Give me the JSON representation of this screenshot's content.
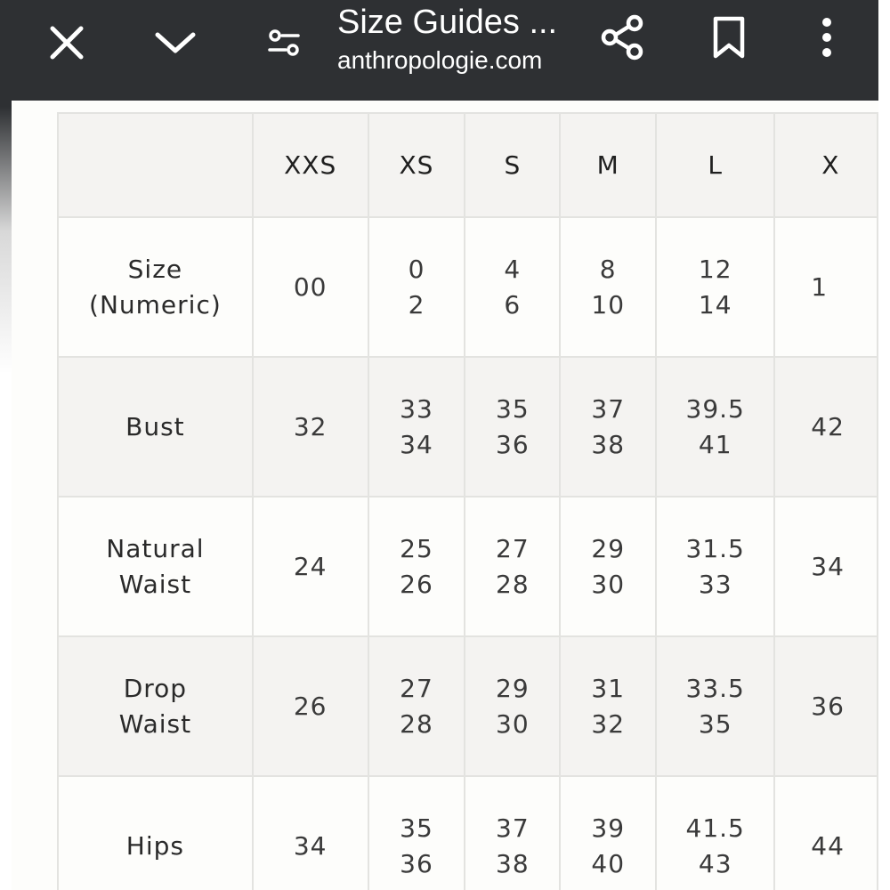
{
  "toolbar": {
    "title": "Size Guides ...",
    "url": "anthropologie.com",
    "icons": [
      "close-icon",
      "chevron-down-icon",
      "page-settings-icon",
      "share-icon",
      "bookmark-icon",
      "more-vertical-icon"
    ]
  },
  "table": {
    "headers": [
      "",
      "XXS",
      "XS",
      "S",
      "M",
      "L",
      "X"
    ],
    "rows": [
      {
        "label": [
          "Size",
          "(Numeric)"
        ],
        "cells": [
          [
            "00"
          ],
          [
            "0",
            "2"
          ],
          [
            "4",
            "6"
          ],
          [
            "8",
            "10"
          ],
          [
            "12",
            "14"
          ],
          [
            "1"
          ]
        ]
      },
      {
        "label": [
          "Bust"
        ],
        "cells": [
          [
            "32"
          ],
          [
            "33",
            "34"
          ],
          [
            "35",
            "36"
          ],
          [
            "37",
            "38"
          ],
          [
            "39.5",
            "41"
          ],
          [
            "42"
          ]
        ]
      },
      {
        "label": [
          "Natural",
          "Waist"
        ],
        "cells": [
          [
            "24"
          ],
          [
            "25",
            "26"
          ],
          [
            "27",
            "28"
          ],
          [
            "29",
            "30"
          ],
          [
            "31.5",
            "33"
          ],
          [
            "34"
          ]
        ]
      },
      {
        "label": [
          "Drop",
          "Waist"
        ],
        "cells": [
          [
            "26"
          ],
          [
            "27",
            "28"
          ],
          [
            "29",
            "30"
          ],
          [
            "31",
            "32"
          ],
          [
            "33.5",
            "35"
          ],
          [
            "36"
          ]
        ]
      },
      {
        "label": [
          "Hips"
        ],
        "cells": [
          [
            "34"
          ],
          [
            "35",
            "36"
          ],
          [
            "37",
            "38"
          ],
          [
            "39",
            "40"
          ],
          [
            "41.5",
            "43"
          ],
          [
            "44"
          ]
        ]
      }
    ]
  },
  "colors": {
    "toolbar_bg": "#2e3033",
    "row_shade": "#f4f3f1",
    "row_plain": "#fdfdfb",
    "grid_line": "#e3e3e0"
  }
}
